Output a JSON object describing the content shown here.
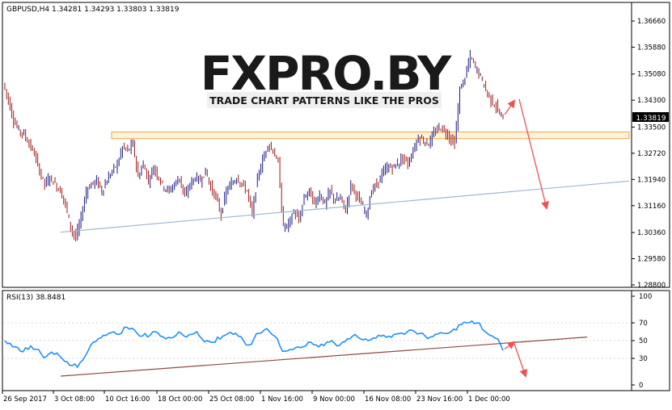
{
  "header": {
    "symbol_line": "GBPUSD,H4  1.34281 1.34293 1.33803 1.33819"
  },
  "watermark": {
    "logo": "FXPRO.BY",
    "tagline": "TRADE CHART PATTERNS LIKE THE PROS"
  },
  "colors": {
    "candle_bull": "#1a1a8c",
    "candle_bear": "#a01818",
    "rsi_line": "#1e90ff",
    "trend_main": "#9fb7d0",
    "trend_rsi": "#8b4a44",
    "arrow": "#f05050",
    "zone_fill": "#fdf3dc",
    "zone_stroke": "#f0a840"
  },
  "chart_data": [
    {
      "type": "candlestick",
      "title": "GBPUSD,H4  1.34281 1.34293 1.33803 1.33819",
      "last_price": "1.33819",
      "y_tick_labels": [
        "1.36660",
        "1.35880",
        "1.35080",
        "1.34300",
        "1.33500",
        "1.32720",
        "1.31940",
        "1.31160",
        "1.30360",
        "1.29580",
        "1.28800"
      ],
      "x_tick_labels": [
        "26 Sep 2017",
        "3 Oct 08:00",
        "10 Oct 16:00",
        "18 Oct 00:00",
        "25 Oct 08:00",
        "1 Nov 16:00",
        "9 Nov 00:00",
        "16 Nov 08:00",
        "23 Nov 16:00",
        "1 Dec 00:00"
      ],
      "ylim": [
        1.288,
        1.3705
      ],
      "close_series": [
        1.348,
        1.343,
        1.337,
        1.334,
        1.333,
        1.33,
        1.327,
        1.322,
        1.318,
        1.32,
        1.318,
        1.316,
        1.312,
        1.305,
        1.302,
        1.308,
        1.316,
        1.318,
        1.319,
        1.316,
        1.319,
        1.322,
        1.324,
        1.329,
        1.328,
        1.33,
        1.32,
        1.324,
        1.319,
        1.323,
        1.32,
        1.317,
        1.316,
        1.318,
        1.32,
        1.314,
        1.318,
        1.32,
        1.319,
        1.322,
        1.317,
        1.314,
        1.309,
        1.316,
        1.318,
        1.32,
        1.318,
        1.316,
        1.309,
        1.32,
        1.325,
        1.33,
        1.328,
        1.324,
        1.305,
        1.306,
        1.31,
        1.307,
        1.314,
        1.316,
        1.312,
        1.315,
        1.312,
        1.316,
        1.313,
        1.314,
        1.31,
        1.318,
        1.315,
        1.312,
        1.309,
        1.316,
        1.318,
        1.321,
        1.323,
        1.323,
        1.324,
        1.326,
        1.324,
        1.328,
        1.332,
        1.331,
        1.33,
        1.333,
        1.335,
        1.334,
        1.332,
        1.33,
        1.346,
        1.35,
        1.356,
        1.353,
        1.35,
        1.346,
        1.343,
        1.341,
        1.338
      ],
      "support_zone": [
        1.333,
        1.335
      ],
      "trendline": {
        "from": 1.3037,
        "to": 1.3122
      },
      "forecast_target": 1.3122
    },
    {
      "type": "line",
      "title": "RSI(13) 38.8481",
      "y_tick_labels": [
        "100",
        "70",
        "50",
        "30",
        "0"
      ],
      "ylim": [
        0,
        100
      ],
      "values": [
        50,
        47,
        43,
        38,
        42,
        44,
        40,
        35,
        32,
        37,
        36,
        30,
        26,
        22,
        20,
        28,
        38,
        48,
        52,
        56,
        58,
        60,
        57,
        65,
        63,
        62,
        55,
        58,
        56,
        60,
        55,
        52,
        53,
        56,
        58,
        54,
        57,
        60,
        52,
        50,
        48,
        54,
        55,
        58,
        57,
        55,
        50,
        45,
        52,
        58,
        62,
        60,
        55,
        44,
        38,
        40,
        42,
        42,
        44,
        48,
        45,
        46,
        48,
        50,
        44,
        48,
        52,
        55,
        54,
        51,
        50,
        53,
        56,
        56,
        55,
        57,
        58,
        57,
        62,
        60,
        58,
        55,
        54,
        57,
        59,
        58,
        60,
        62,
        68,
        70,
        72,
        70,
        63,
        58,
        55,
        52,
        38.8
      ],
      "trendline": {
        "from": 10,
        "to": 54
      }
    }
  ]
}
